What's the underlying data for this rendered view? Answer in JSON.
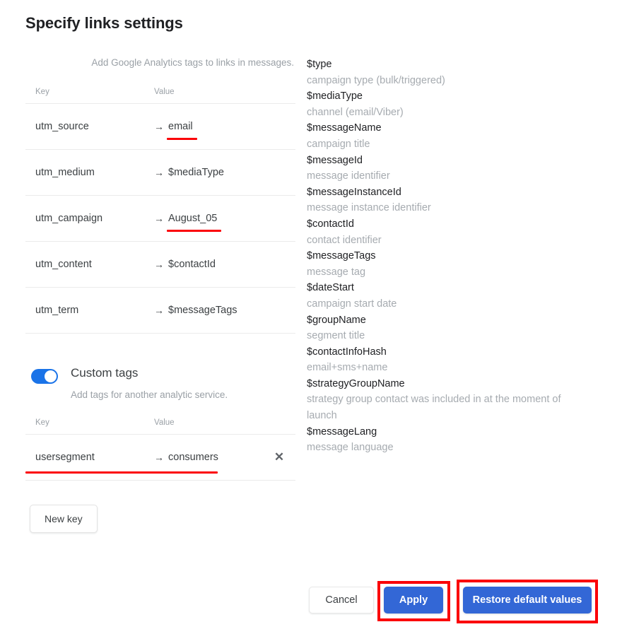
{
  "page": {
    "title": "Specify links settings"
  },
  "ga_section": {
    "hint": "Add Google Analytics tags to links in messages.",
    "columns": {
      "key": "Key",
      "value": "Value"
    },
    "rows": [
      {
        "key": "utm_source",
        "arrow": "→",
        "value": "email",
        "annotated": true
      },
      {
        "key": "utm_medium",
        "arrow": "→",
        "value": "$mediaType",
        "annotated": false
      },
      {
        "key": "utm_campaign",
        "arrow": "→",
        "value": "August_05",
        "annotated": true
      },
      {
        "key": "utm_content",
        "arrow": "→",
        "value": "$contactId",
        "annotated": false
      },
      {
        "key": "utm_term",
        "arrow": "→",
        "value": "$messageTags",
        "annotated": false
      }
    ]
  },
  "custom_section": {
    "toggle_state": "on",
    "title": "Custom tags",
    "hint": "Add tags for another analytic service.",
    "columns": {
      "key": "Key",
      "value": "Value"
    },
    "rows": [
      {
        "key": "usersegment",
        "arrow": "→",
        "value": "consumers",
        "remove_icon": "✕",
        "annotated": true
      }
    ],
    "new_key_label": "New key"
  },
  "variables": [
    {
      "name": "$type",
      "desc": "campaign type (bulk/triggered)"
    },
    {
      "name": "$mediaType",
      "desc": "channel (email/Viber)"
    },
    {
      "name": "$messageName",
      "desc": "campaign title"
    },
    {
      "name": "$messageId",
      "desc": "message identifier"
    },
    {
      "name": "$messageInstanceId",
      "desc": "message instance identifier"
    },
    {
      "name": "$contactId",
      "desc": "contact identifier"
    },
    {
      "name": "$messageTags",
      "desc": "message tag"
    },
    {
      "name": "$dateStart",
      "desc": "campaign start date"
    },
    {
      "name": "$groupName",
      "desc": "segment title"
    },
    {
      "name": "$contactInfoHash",
      "desc": "email+sms+name"
    },
    {
      "name": "$strategyGroupName",
      "desc": "strategy group contact was included in at the moment of launch"
    },
    {
      "name": "$messageLang",
      "desc": "message language"
    }
  ],
  "footer": {
    "cancel_label": "Cancel",
    "apply_label": "Apply",
    "restore_label": "Restore default values"
  },
  "colors": {
    "accent_blue": "#1a73e8",
    "button_blue": "#3367d6",
    "annotation_red": "#fb0007",
    "muted_text": "#9aa0a6"
  }
}
